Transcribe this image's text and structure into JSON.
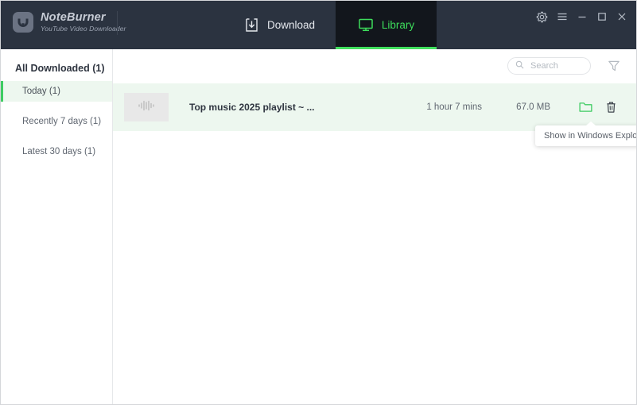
{
  "app": {
    "brand_name": "NoteBurner",
    "brand_subtitle": "YouTube Video Downloader",
    "logo_icon": "noteburner-logo-icon"
  },
  "header": {
    "tabs": [
      {
        "label": "Download",
        "icon": "download-tray-icon",
        "active": false
      },
      {
        "label": "Library",
        "icon": "monitor-icon",
        "active": true
      }
    ],
    "window_controls": [
      {
        "name": "settings-gear-button",
        "icon": "gear-icon"
      },
      {
        "name": "menu-button",
        "icon": "hamburger-menu-icon"
      },
      {
        "name": "minimize-button",
        "icon": "minimize-icon"
      },
      {
        "name": "maximize-button",
        "icon": "maximize-icon"
      },
      {
        "name": "close-button",
        "icon": "close-icon"
      }
    ]
  },
  "sidebar": {
    "title": "All Downloaded (1)",
    "items": [
      {
        "label": "Today (1)",
        "selected": true
      },
      {
        "label": "Recently 7 days (1)",
        "selected": false
      },
      {
        "label": "Latest 30 days (1)",
        "selected": false
      }
    ]
  },
  "toolbar": {
    "search_placeholder": "Search",
    "search_value": "",
    "search_icon": "search-icon",
    "filter_icon": "filter-funnel-icon"
  },
  "library": {
    "rows": [
      {
        "title": "Top music 2025 playlist ~ ...",
        "duration": "1 hour 7 mins",
        "size": "67.0 MB",
        "thumb_icon": "audio-waveform-icon",
        "open_folder_icon": "folder-open-icon",
        "delete_icon": "trash-icon"
      }
    ]
  },
  "tooltip": {
    "text": "Show in Windows Explorer"
  },
  "colors": {
    "header_bg": "#2b3340",
    "active_tab_bg": "#12161c",
    "accent_green": "#41e05e",
    "row_highlight": "#edf7ef",
    "sidebar_accent": "#3fcc63",
    "text_dark": "#2f3540",
    "text_muted": "#5f6670"
  }
}
